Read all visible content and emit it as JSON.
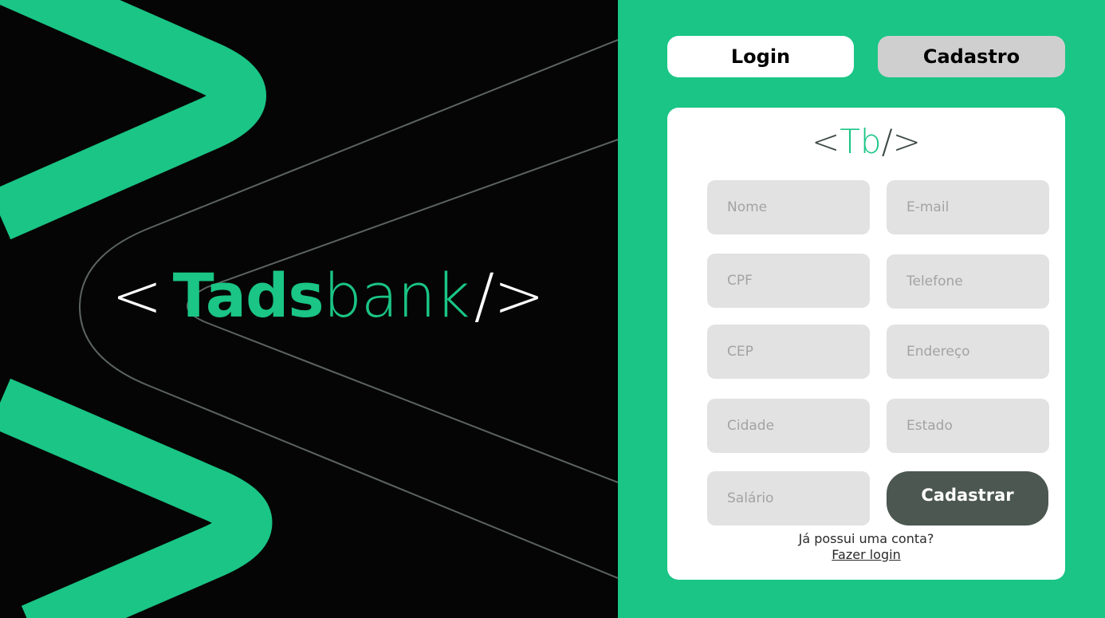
{
  "brand": {
    "open": "<",
    "tads": "Tads",
    "bank": "bank",
    "close": "/>"
  },
  "tabs": {
    "login": "Login",
    "cadastro": "Cadastro"
  },
  "card_logo": {
    "open": "<",
    "tb": "Tb",
    "close": "/>"
  },
  "form": {
    "nome": "Nome",
    "email": "E-mail",
    "cpf": "CPF",
    "telefone": "Telefone",
    "cep": "CEP",
    "endereco": "Endereço",
    "cidade": "Cidade",
    "estado": "Estado",
    "salario": "Salário",
    "submit": "Cadastrar"
  },
  "footer": {
    "question": "Já possui uma conta?",
    "link": "Fazer login"
  },
  "colors": {
    "accent": "#1ac585",
    "dark_button": "#4b5750",
    "panel_bg": "#050505",
    "input_bg": "#e2e2e2",
    "inactive_tab": "#cfcfcf"
  }
}
